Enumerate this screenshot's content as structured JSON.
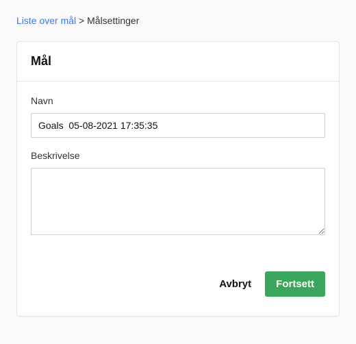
{
  "breadcrumb": {
    "link_label": "Liste over mål",
    "separator": ">",
    "current": "Målsettinger"
  },
  "card": {
    "title": "Mål",
    "name_label": "Navn",
    "name_value": "Goals  05-08-2021 17:35:35",
    "description_label": "Beskrivelse",
    "description_value": ""
  },
  "actions": {
    "cancel": "Avbryt",
    "continue": "Fortsett"
  }
}
